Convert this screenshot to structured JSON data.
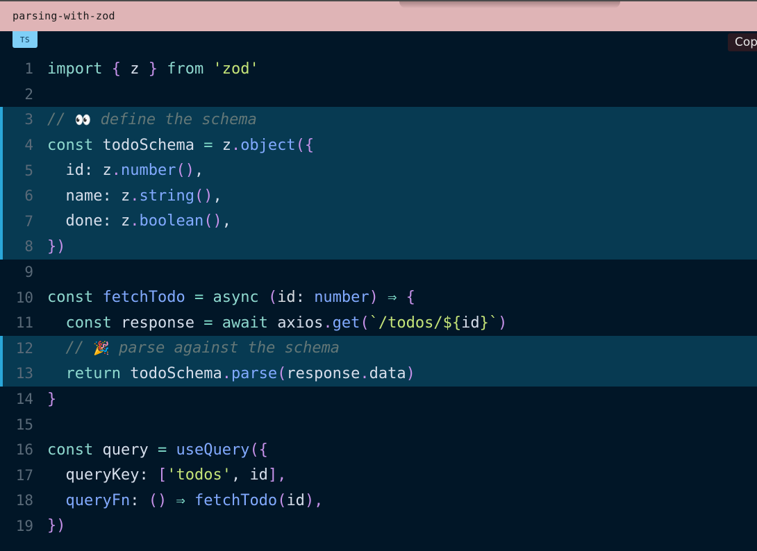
{
  "header": {
    "filename": "parsing-with-zod"
  },
  "badge": {
    "language": "TS"
  },
  "toolbar": {
    "copy_label": "Copy"
  },
  "code": {
    "line_numbers": [
      "1",
      "2",
      "3",
      "4",
      "5",
      "6",
      "7",
      "8",
      "9",
      "10",
      "11",
      "12",
      "13",
      "14",
      "15",
      "16",
      "17",
      "18",
      "19"
    ],
    "highlighted_lines": [
      3,
      4,
      5,
      6,
      7,
      8,
      12,
      13
    ],
    "tokens": {
      "l1": [
        "import",
        "{",
        "z",
        "}",
        "from",
        "'zod'"
      ],
      "l3": [
        "//",
        "👀",
        "define the schema"
      ],
      "l4": [
        "const",
        "todoSchema",
        "=",
        "z",
        ".",
        "object",
        "({"
      ],
      "l5": [
        "id",
        ":",
        "z",
        ".",
        "number",
        "()",
        ","
      ],
      "l6": [
        "name",
        ":",
        "z",
        ".",
        "string",
        "()",
        ","
      ],
      "l7": [
        "done",
        ":",
        "z",
        ".",
        "boolean",
        "()",
        ","
      ],
      "l8": [
        "})"
      ],
      "l10": [
        "const",
        "fetchTodo",
        "=",
        "async",
        "(",
        "id",
        ":",
        "number",
        ")",
        "⇒",
        "{"
      ],
      "l11": [
        "const",
        "response",
        "=",
        "await",
        "axios",
        ".",
        "get",
        "(",
        "`/todos/${",
        "id",
        "}`",
        ")"
      ],
      "l12": [
        "//",
        "🎉",
        "parse against the schema"
      ],
      "l13": [
        "return",
        "todoSchema",
        ".",
        "parse",
        "(",
        "response",
        ".",
        "data",
        ")"
      ],
      "l14": [
        "}"
      ],
      "l16": [
        "const",
        "query",
        "=",
        "useQuery",
        "({"
      ],
      "l17": [
        "queryKey",
        ":",
        "[",
        "'todos'",
        ",",
        "id",
        "],"
      ],
      "l18": [
        "queryFn",
        ":",
        "()",
        "⇒",
        "fetchTodo",
        "(",
        "id",
        "),"
      ],
      "l19": [
        "})"
      ]
    }
  }
}
